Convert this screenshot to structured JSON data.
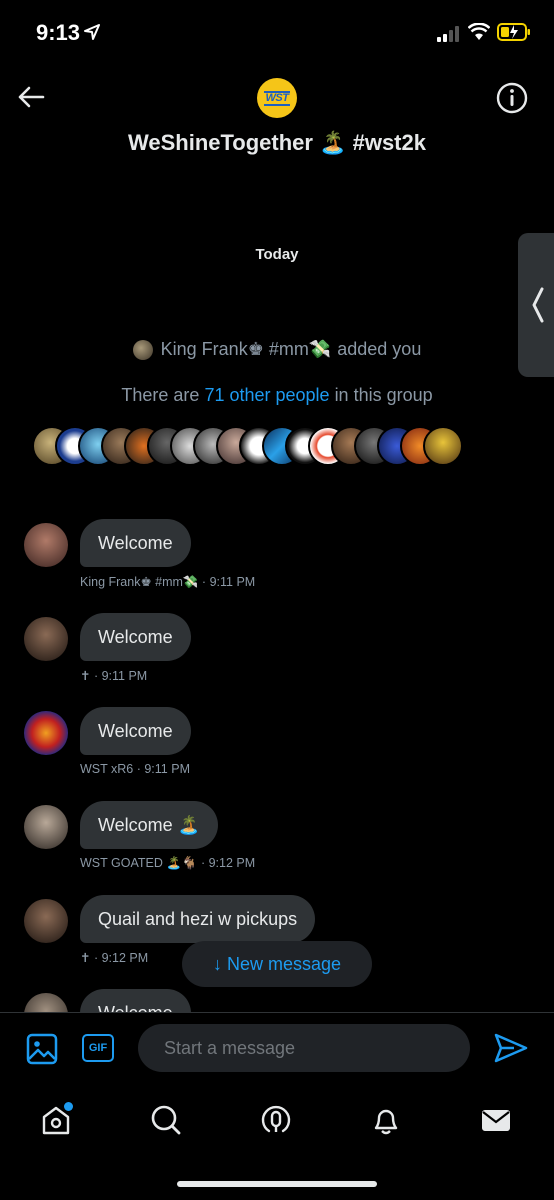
{
  "status_bar": {
    "time": "9:13"
  },
  "header": {
    "group_avatar_text": "WST",
    "title": "WeShineTogether 🏝️ #wst2k"
  },
  "date_separator": "Today",
  "system": {
    "added_by": "King Frank♚ #mm💸",
    "added_suffix": "added you",
    "others_prefix": "There are",
    "others_link": "71 other people",
    "others_suffix": "in this group"
  },
  "messages": [
    {
      "text": "Welcome",
      "meta": "King Frank♚ #mm💸 · 9:11 PM"
    },
    {
      "text": "Welcome",
      "meta": "✝ · 9:11 PM"
    },
    {
      "text": "Welcome",
      "meta": "WST xR6 · 9:11 PM"
    },
    {
      "text": "Welcome 🏝️",
      "meta": "WST GOATED 🏝️🐐 · 9:12 PM"
    },
    {
      "text": "Quail and hezi w pickups",
      "meta": "✝ · 9:12 PM"
    },
    {
      "text": "Welcome",
      "meta": ""
    }
  ],
  "new_message_label": "↓ New message",
  "composer": {
    "gif_label": "GIF",
    "placeholder": "Start a message"
  },
  "icons": {
    "back": "arrow-left-icon",
    "info": "info-icon",
    "image": "image-icon",
    "send": "send-icon",
    "home": "home-icon",
    "search": "search-icon",
    "spaces": "spaces-icon",
    "notifications": "bell-icon",
    "messages": "envelope-icon"
  },
  "colors": {
    "accent": "#1d9bf0",
    "bubble": "#2f3336",
    "muted": "#8b98a5"
  }
}
